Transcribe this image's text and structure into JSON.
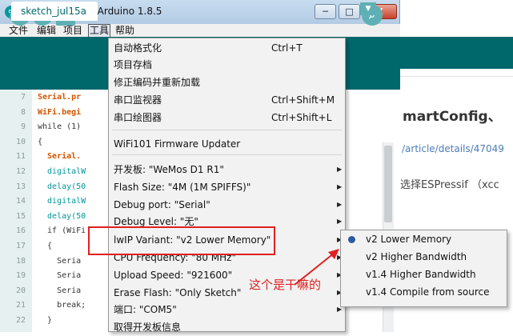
{
  "window": {
    "title": "sketch_jul15a | Arduino 1.8.5",
    "icon_glyph": "∞",
    "minimize": "─",
    "maximize": "□",
    "close": "X"
  },
  "menubar": {
    "file": "文件",
    "edit": "编辑",
    "project": "项目",
    "tools": "工具",
    "help": "帮助"
  },
  "toolbar": {
    "verify_glyph": "✓",
    "upload_glyph": "→",
    "new_glyph": "▤",
    "serial_glyph": "⌕"
  },
  "tabs": {
    "sketch": "sketch_jul15a",
    "menu_glyph": "▼"
  },
  "editor": {
    "line_numbers": [
      "7",
      "8",
      "9",
      "10",
      "11",
      "12",
      "13",
      "14",
      "15",
      "16",
      "17",
      "18",
      "19",
      "20",
      "21",
      "22"
    ],
    "lines": [
      "Serial.pr",
      "WiFi.begi",
      "while (1)",
      "{",
      "  Serial.",
      "  digitalW",
      "  delay(50",
      "  digitalW",
      "  delay(50",
      "  if (WiFi",
      "  {",
      "    Seria",
      "    Seria",
      "    Seria",
      "    break;",
      "  }"
    ]
  },
  "web": {
    "heading": "martConfig、",
    "link": "/article/details/47049",
    "text": "选择ESPressif （xcc"
  },
  "tools_menu": {
    "items": [
      {
        "label": "自动格式化",
        "shortcut": "Ctrl+T"
      },
      {
        "label": "项目存档",
        "shortcut": ""
      },
      {
        "label": "修正编码并重新加载",
        "shortcut": ""
      },
      {
        "label": "串口监视器",
        "shortcut": "Ctrl+Shift+M"
      },
      {
        "label": "串口绘图器",
        "shortcut": "Ctrl+Shift+L"
      },
      {
        "label": "WiFi101 Firmware Updater",
        "shortcut": ""
      },
      {
        "label": "开发板: \"WeMos D1 R1\"",
        "submenu": true
      },
      {
        "label": "Flash Size: \"4M (1M SPIFFS)\"",
        "submenu": true
      },
      {
        "label": "Debug port: \"Serial\"",
        "submenu": true
      },
      {
        "label": "Debug Level: \"无\"",
        "submenu": true
      },
      {
        "label": "lwIP Variant: \"v2 Lower Memory\"",
        "submenu": true
      },
      {
        "label": "CPU Frequency: \"80 MHz\"",
        "submenu": true
      },
      {
        "label": "Upload Speed: \"921600\"",
        "submenu": true
      },
      {
        "label": "Erase Flash: \"Only Sketch\"",
        "submenu": true
      },
      {
        "label": "端口: \"COM5\"",
        "submenu": true
      },
      {
        "label": "取得开发板信息",
        "shortcut": ""
      }
    ],
    "arrow_glyph": "▶"
  },
  "lwip_submenu": {
    "selected_index": 0,
    "items": [
      "v2 Lower Memory",
      "v2 Higher Bandwidth",
      "v1.4 Higher Bandwidth",
      "v1.4 Compile from source"
    ]
  },
  "annotation": {
    "text": "这个是干嘛的",
    "color": "#e02020"
  },
  "colors": {
    "toolbar": "#00676b",
    "accent": "#00979c"
  }
}
